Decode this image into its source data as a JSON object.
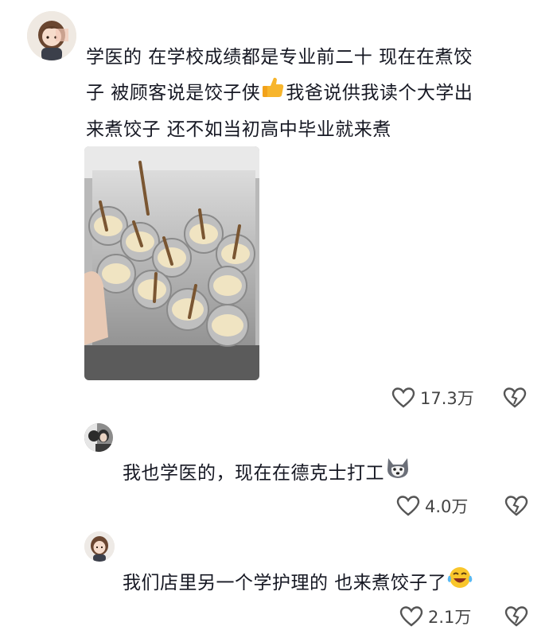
{
  "comments": [
    {
      "text_line1": "学医的 在学校成绩都是专业前二十 现在在煮饺",
      "text_line2a": "子 被顾客说是饺子侠",
      "text_line2b": "我爸说供我读个大学出",
      "text_line3": "来煮饺子 还不如当初高中毕业就来煮",
      "emoji": "thumbs-up-icon",
      "like_count": "17.3万"
    },
    {
      "text": "我也学医的，现在在德克士打工",
      "emoji": "husky-dog-icon",
      "like_count": "4.0万"
    },
    {
      "text": "我们店里另一个学护理的 也来煮饺子了",
      "emoji": "laughing-crying-icon",
      "like_count": "2.1万"
    }
  ],
  "colors": {
    "text": "#161823",
    "meta": "#444444",
    "background": "#ffffff"
  }
}
